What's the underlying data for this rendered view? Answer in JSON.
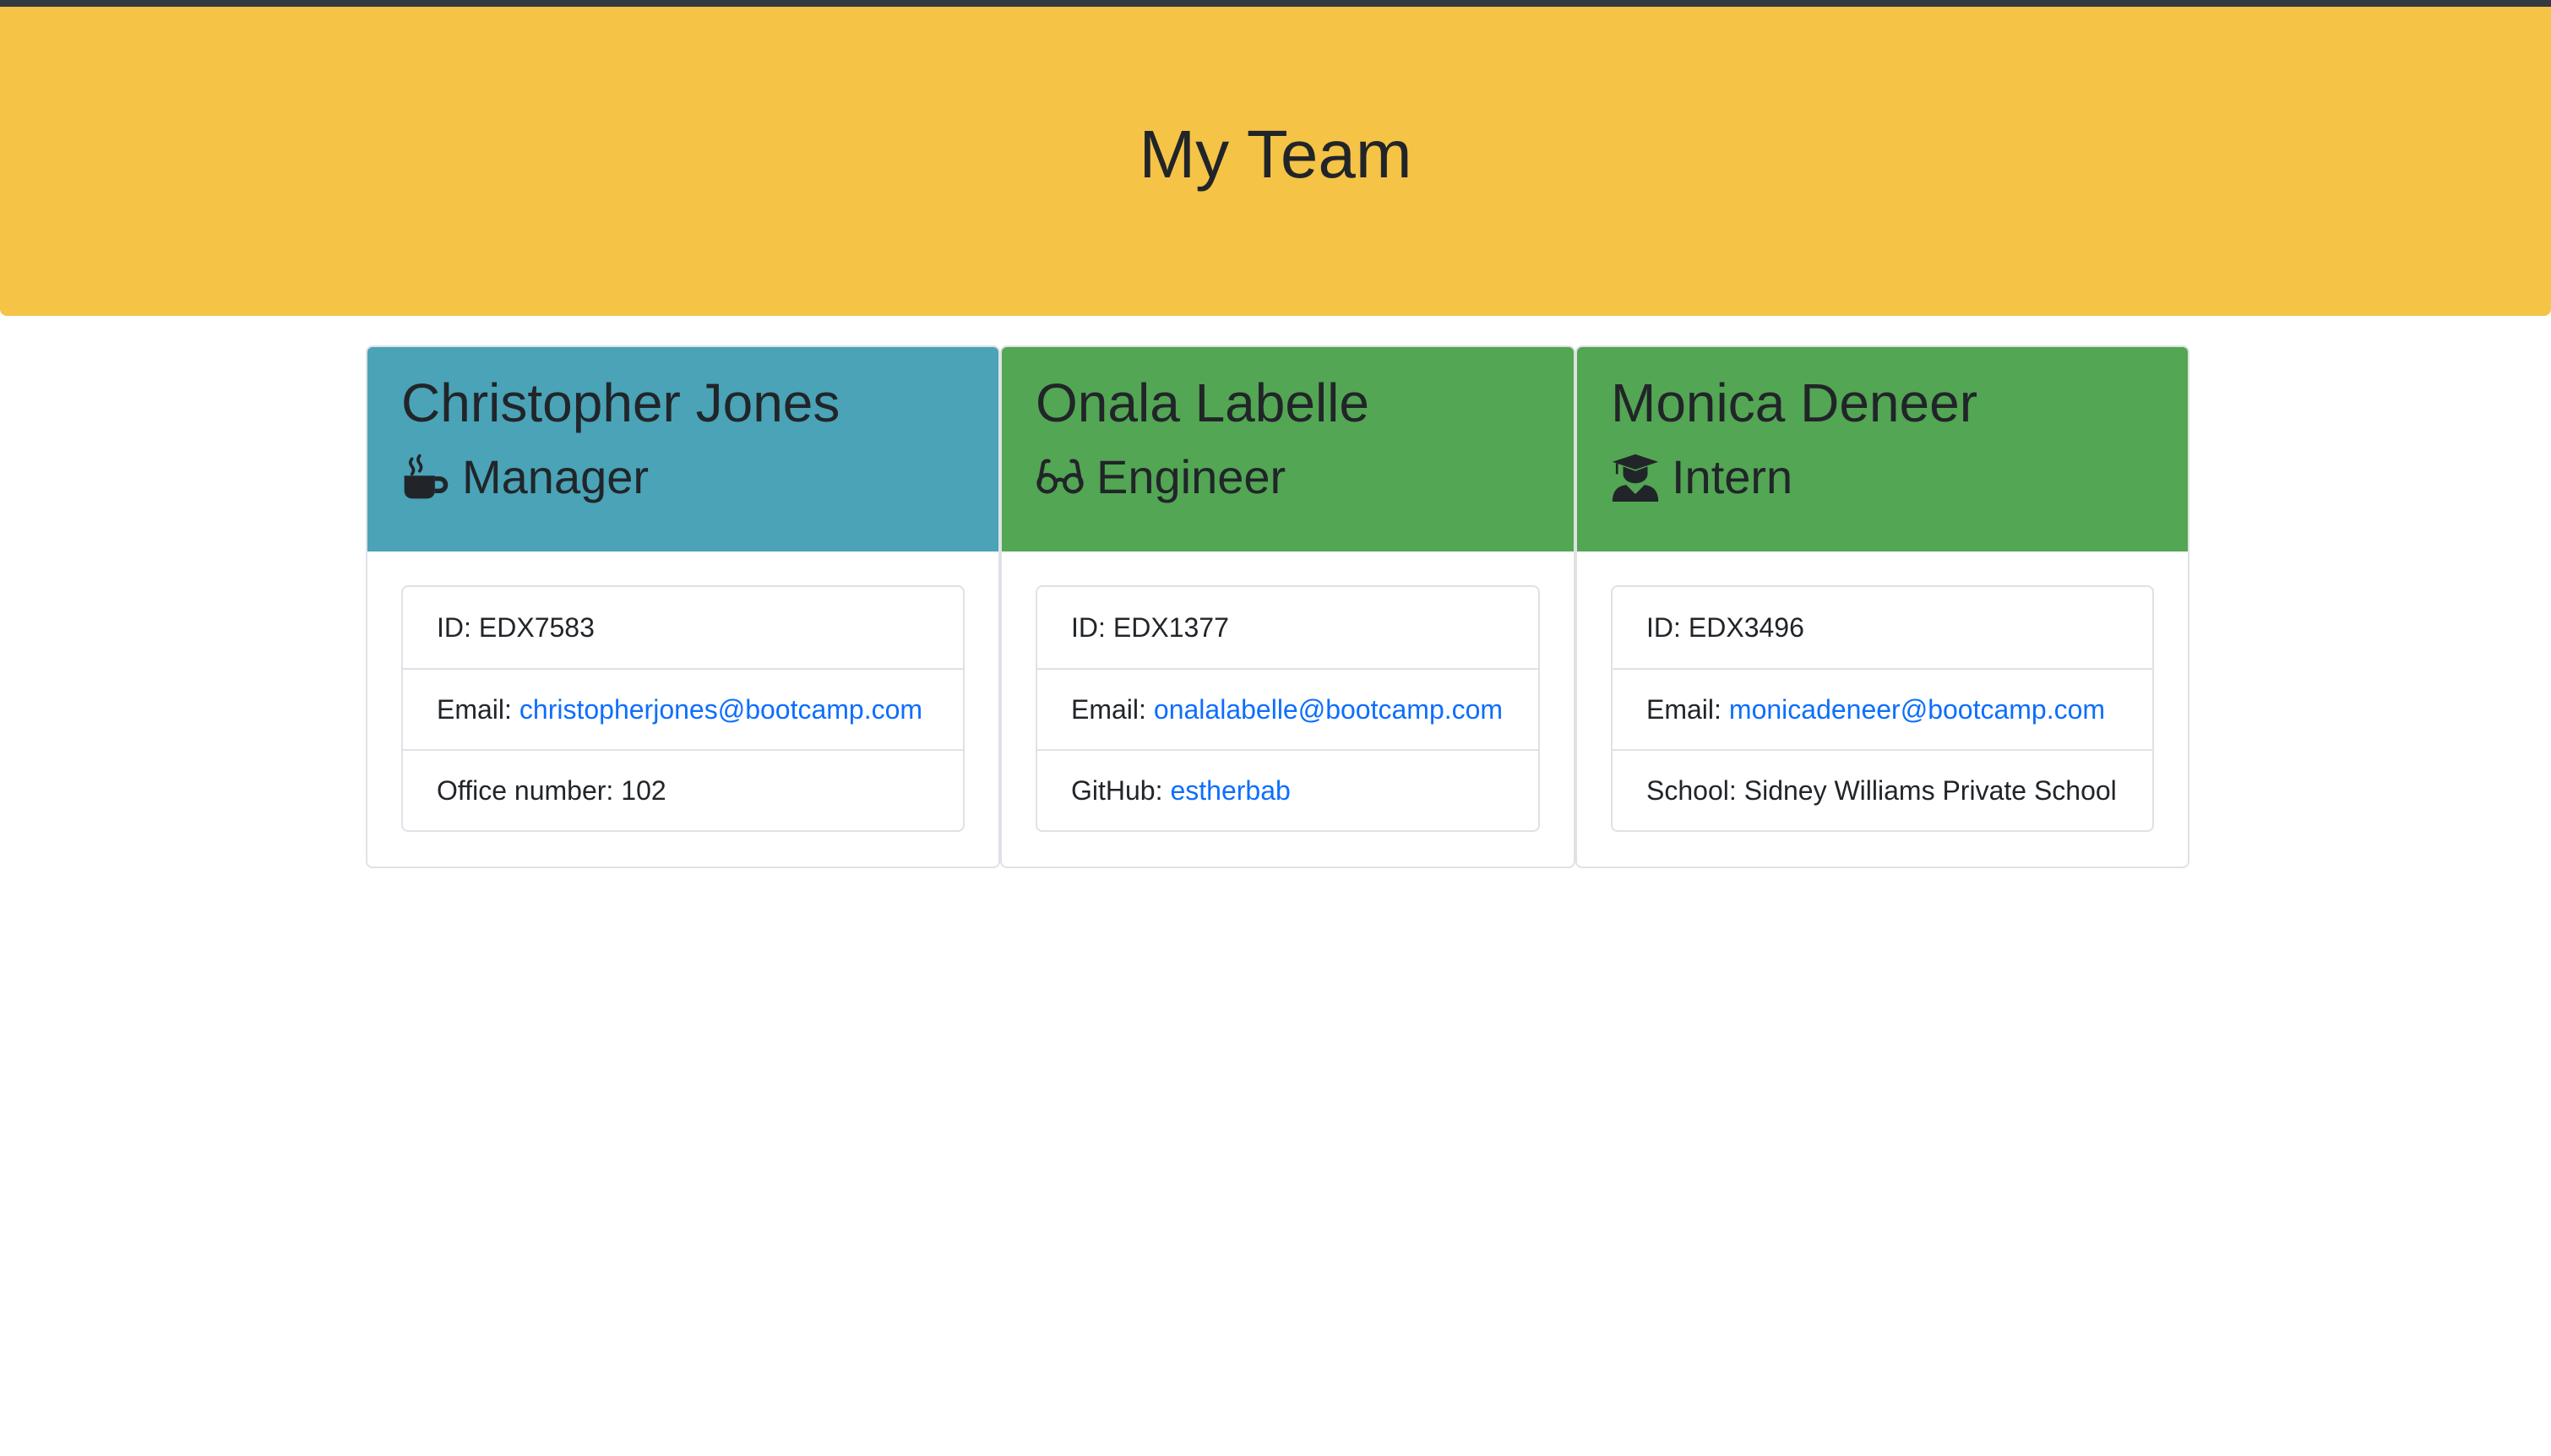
{
  "header": {
    "title": "My Team"
  },
  "team": [
    {
      "name": "Christopher Jones",
      "role": "Manager",
      "icon": "coffee-icon",
      "header_color": "#4aa3b7",
      "id_label": "ID:",
      "id": "EDX7583",
      "email_label": "Email:",
      "email": "christopherjones@bootcamp.com",
      "extra_label": "Office number:",
      "extra": "102"
    },
    {
      "name": "Onala Labelle",
      "role": "Engineer",
      "icon": "glasses-icon",
      "header_color": "#53a653",
      "id_label": "ID:",
      "id": "EDX1377",
      "email_label": "Email:",
      "email": "onalalabelle@bootcamp.com",
      "extra_label": "GitHub:",
      "extra": "estherbab"
    },
    {
      "name": "Monica Deneer",
      "role": "Intern",
      "icon": "graduate-icon",
      "header_color": "#53a653",
      "id_label": "ID:",
      "id": "EDX3496",
      "email_label": "Email:",
      "email": "monicadeneer@bootcamp.com",
      "extra_label": "School:",
      "extra": "Sidney Williams Private School"
    }
  ],
  "colors": {
    "jumbotron": "#f5c345",
    "link": "#0d6efd",
    "manager_header": "#4aa3b7",
    "employee_header": "#53a653"
  }
}
